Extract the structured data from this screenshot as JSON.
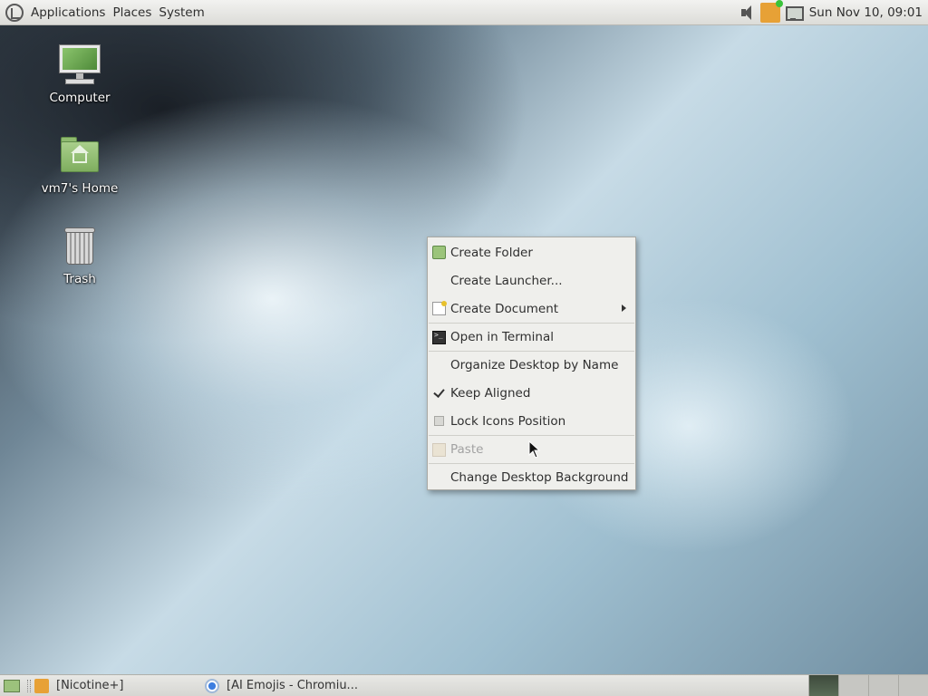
{
  "top_panel": {
    "menus": [
      "Applications",
      "Places",
      "System"
    ],
    "clock": "Sun Nov 10, 09:01"
  },
  "desktop": {
    "icons": [
      {
        "label": "Computer",
        "icon": "computer-icon"
      },
      {
        "label": "vm7's Home",
        "icon": "home-folder-icon"
      },
      {
        "label": "Trash",
        "icon": "trash-icon"
      }
    ]
  },
  "context_menu": {
    "items": [
      {
        "label": "Create Folder",
        "icon": "folder-icon"
      },
      {
        "label": "Create Launcher...",
        "icon": ""
      },
      {
        "label": "Create Document",
        "icon": "document-icon",
        "submenu": true
      },
      {
        "label": "Open in Terminal",
        "icon": "terminal-icon"
      },
      {
        "label": "Organize Desktop by Name",
        "icon": ""
      },
      {
        "label": "Keep Aligned",
        "icon": "check-icon",
        "checked": true
      },
      {
        "label": "Lock Icons Position",
        "icon": "checkbox-icon",
        "checked": false
      },
      {
        "label": "Paste",
        "icon": "paste-icon",
        "disabled": true
      },
      {
        "label": "Change Desktop Background",
        "icon": ""
      }
    ]
  },
  "bottom_panel": {
    "tasks": [
      {
        "label": "[Nicotine+]",
        "icon": "nicotine-icon"
      },
      {
        "label": "[AI Emojis - Chromiu...",
        "icon": "chromium-icon"
      }
    ],
    "workspaces": 4
  }
}
